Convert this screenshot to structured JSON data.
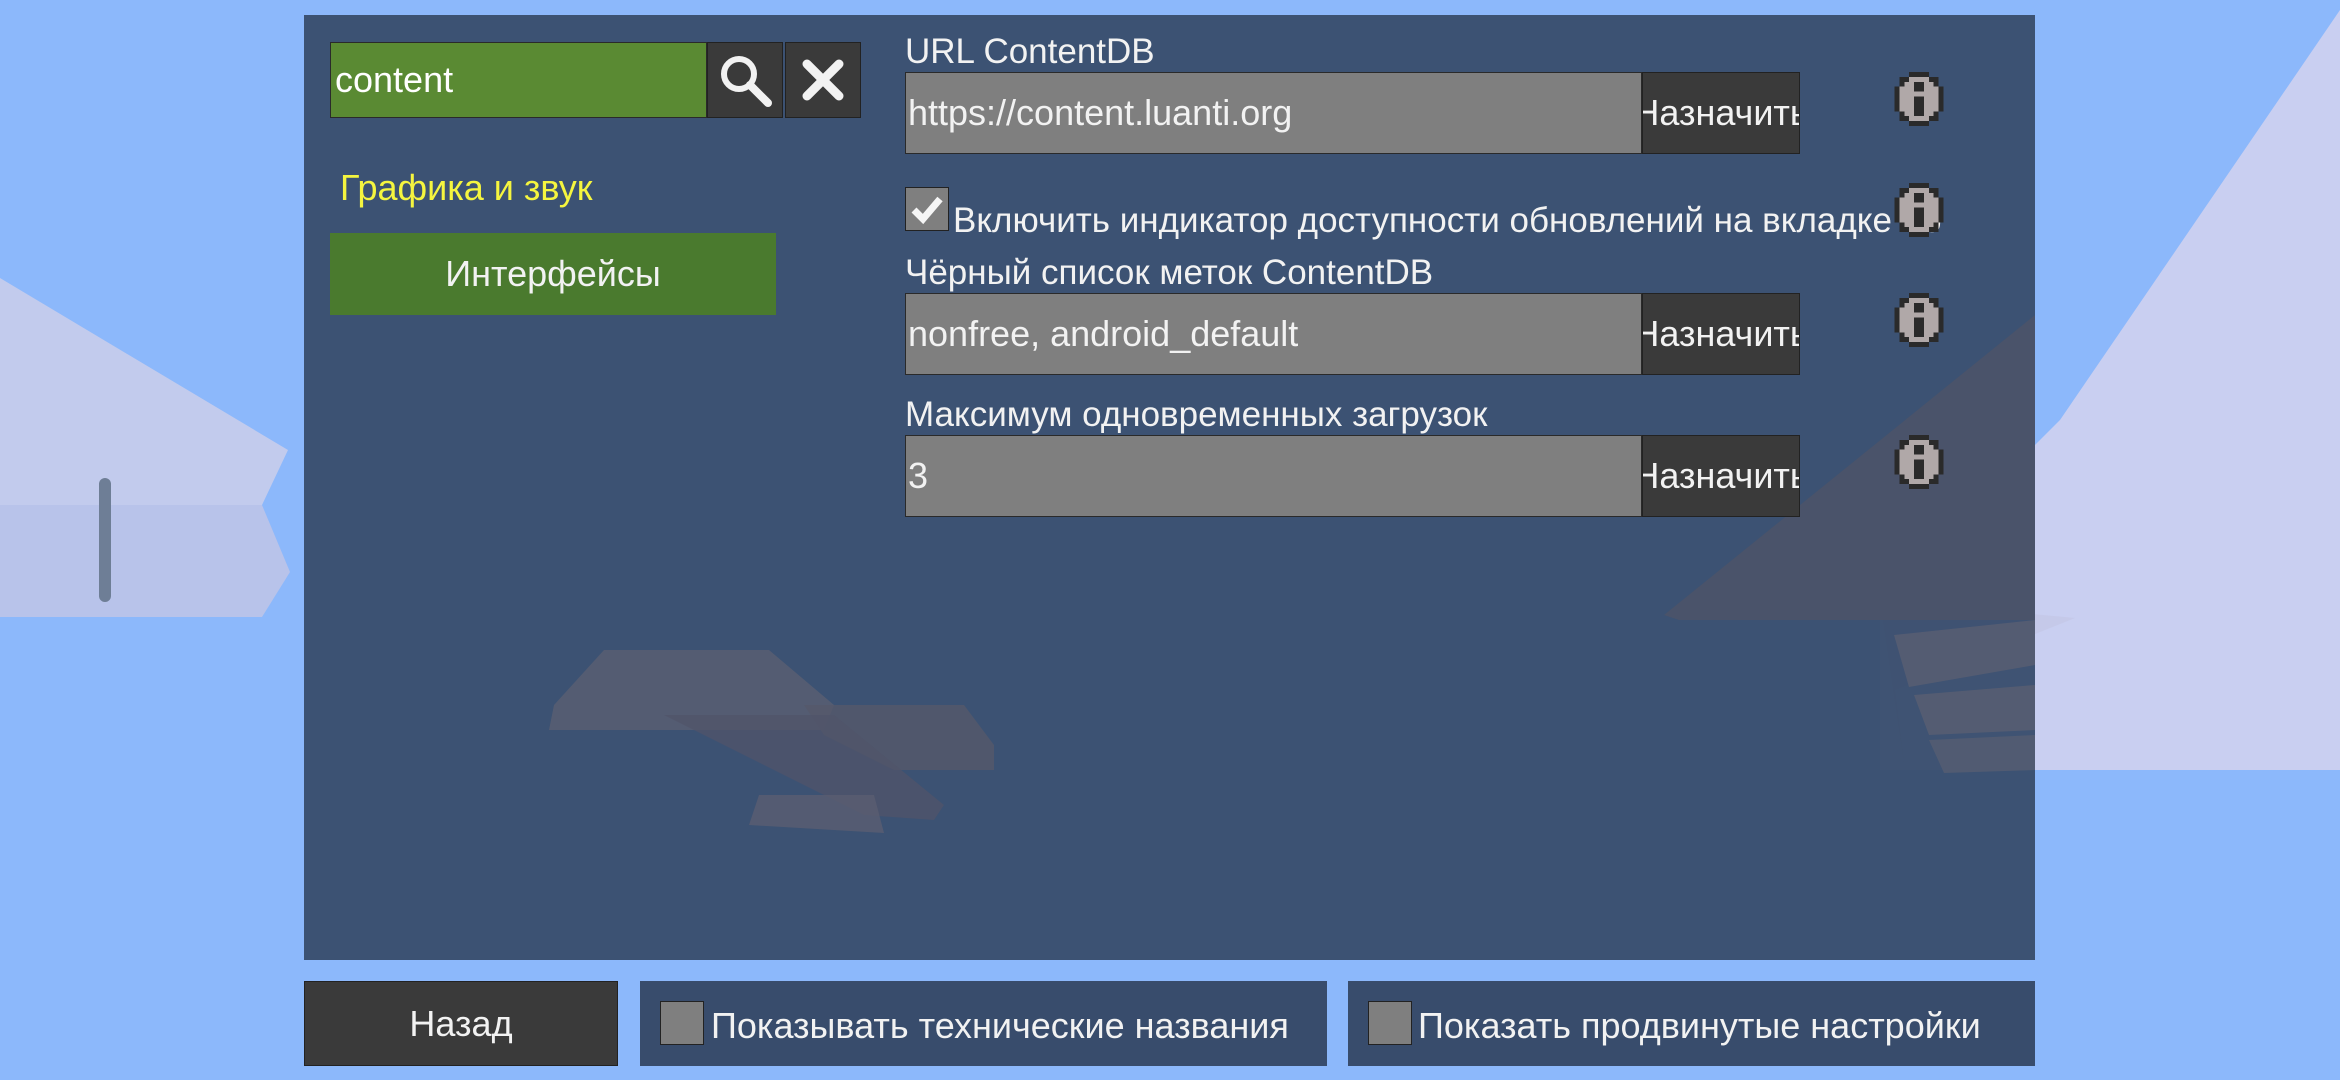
{
  "search": {
    "value": "content"
  },
  "sidebar": {
    "category": "Графика и звук",
    "items": [
      {
        "label": "Интерфейсы"
      }
    ]
  },
  "settings": [
    {
      "label": "URL ContentDB",
      "value": "https://content.luanti.org",
      "button": "Назначить"
    },
    {
      "checkbox_label": "Включить индикатор доступности обновлений на вкладке Ко",
      "checked": true
    },
    {
      "label": "Чёрный список меток ContentDB",
      "value": "nonfree, android_default",
      "button": "Назначить"
    },
    {
      "label": "Максимум одновременных загрузок",
      "value": "3",
      "button": "Назначить"
    }
  ],
  "footer": {
    "back_label": "Назад",
    "show_technical_names": "Показывать технические названия",
    "show_advanced": "Показать продвинутые настройки"
  },
  "colors": {
    "sky": "#8cb8fb",
    "panel": "#384c6c",
    "search_bg": "#5a8a33",
    "selected_item": "#4a7a2e",
    "category_text": "#f5f53f",
    "field_bg": "#7f7f7f",
    "button_bg": "#3a3a3a"
  },
  "icons": [
    "search-icon",
    "close-icon",
    "info-icon",
    "checkmark-icon"
  ]
}
